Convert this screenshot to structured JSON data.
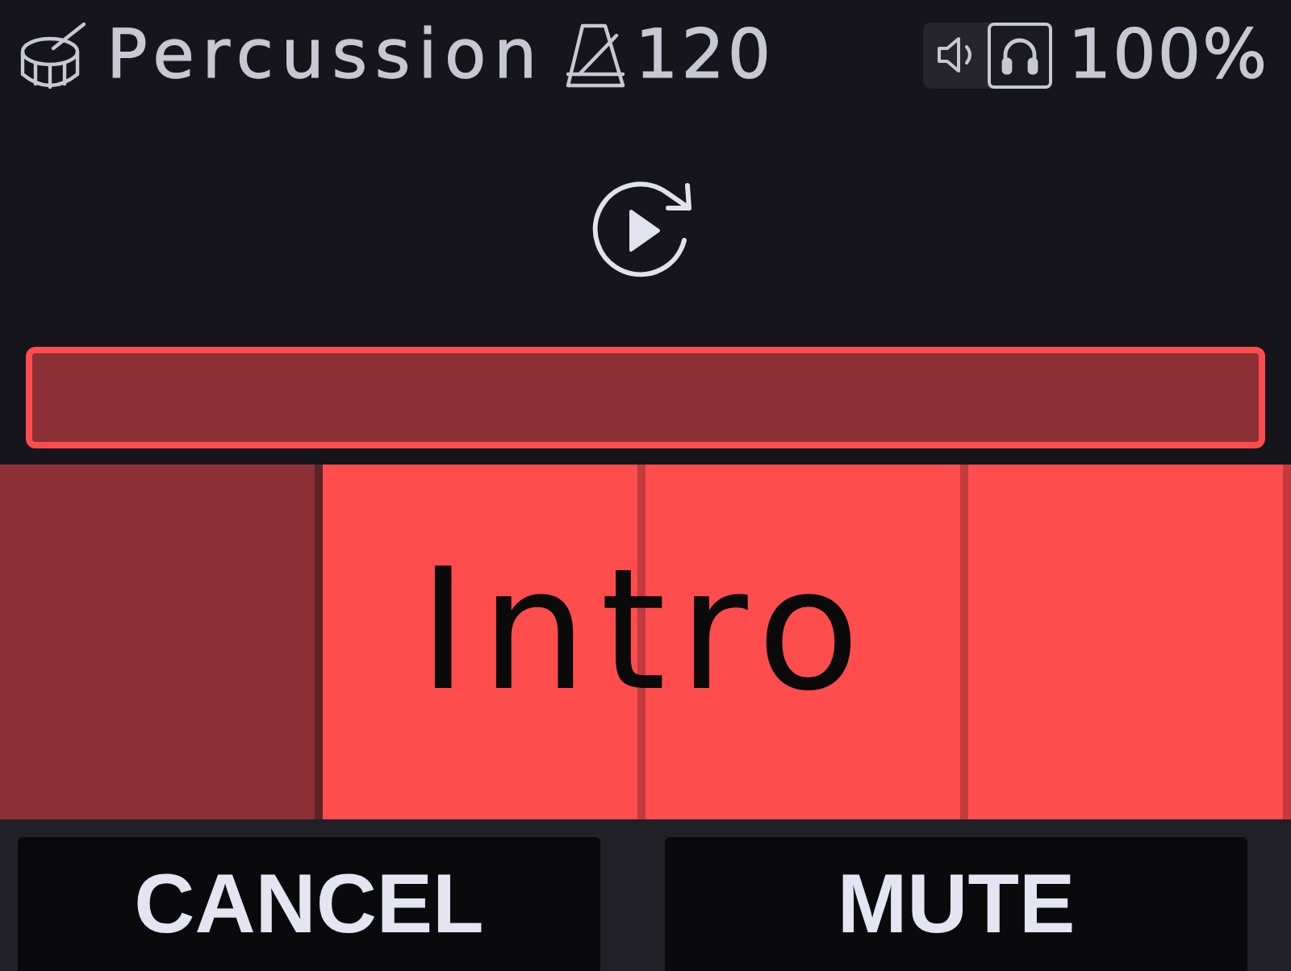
{
  "header": {
    "title": "Percussion",
    "tempo": "120",
    "outputs": [
      {
        "kind": "speaker",
        "selected": false
      },
      {
        "kind": "headphones",
        "selected": true
      }
    ],
    "volume": "100%"
  },
  "segments": [
    {
      "played": true
    },
    {
      "played": false
    },
    {
      "played": false
    },
    {
      "played": false
    }
  ],
  "section": {
    "label": "Intro"
  },
  "buttons": [
    {
      "label": "CANCEL"
    },
    {
      "label": "MUTE"
    }
  ]
}
